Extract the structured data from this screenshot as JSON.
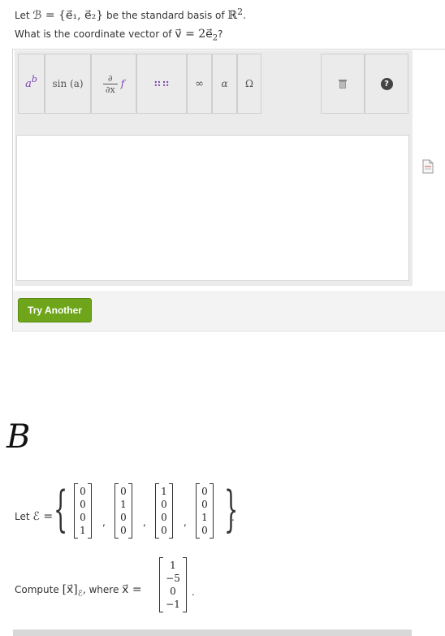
{
  "question1": {
    "line1_prefix": "Let",
    "line1_math": "ℬ = {e⃗₁, e⃗₂}",
    "line1_mid": "be the standard basis of",
    "line1_end": "ℝ",
    "line1_sup": "2",
    "line1_period": ".",
    "line2_prefix": "What is the coordinate vector of",
    "line2_math": "v⃗ = 2e⃗",
    "line2_sub": "2",
    "line2_end": "?"
  },
  "toolbar": {
    "power_label": "a",
    "power_sup": "b",
    "sin_label": "sin (a)",
    "deriv_top": "∂",
    "deriv_bottom": "∂x",
    "deriv_f": "f",
    "matrix_label": "⠶⠶",
    "infinity_label": "∞",
    "alpha_label": "α",
    "omega_label": "Ω",
    "trash_icon": "trash-icon",
    "help_icon": "help-icon",
    "help_glyph": "?"
  },
  "answer_box": {
    "value": ""
  },
  "try_another_label": "Try Another",
  "handwritten_label": "B",
  "question2": {
    "let_prefix": "Let",
    "basis_symbol": "ℰ =",
    "basis_vectors": [
      [
        "0",
        "0",
        "0",
        "1"
      ],
      [
        "0",
        "1",
        "0",
        "0"
      ],
      [
        "1",
        "0",
        "0",
        "0"
      ],
      [
        "0",
        "0",
        "1",
        "0"
      ]
    ],
    "compute_prefix": "Compute",
    "compute_math": "[x⃗]",
    "compute_sub": "ℰ",
    "compute_where": ", where",
    "x_math": "x⃗ =",
    "x_vector": [
      "1",
      "−5",
      "0",
      "−1"
    ],
    "x_period": "."
  },
  "colors": {
    "accent_green": "#6ea51a",
    "toolbar_grey": "#ebebeb"
  }
}
